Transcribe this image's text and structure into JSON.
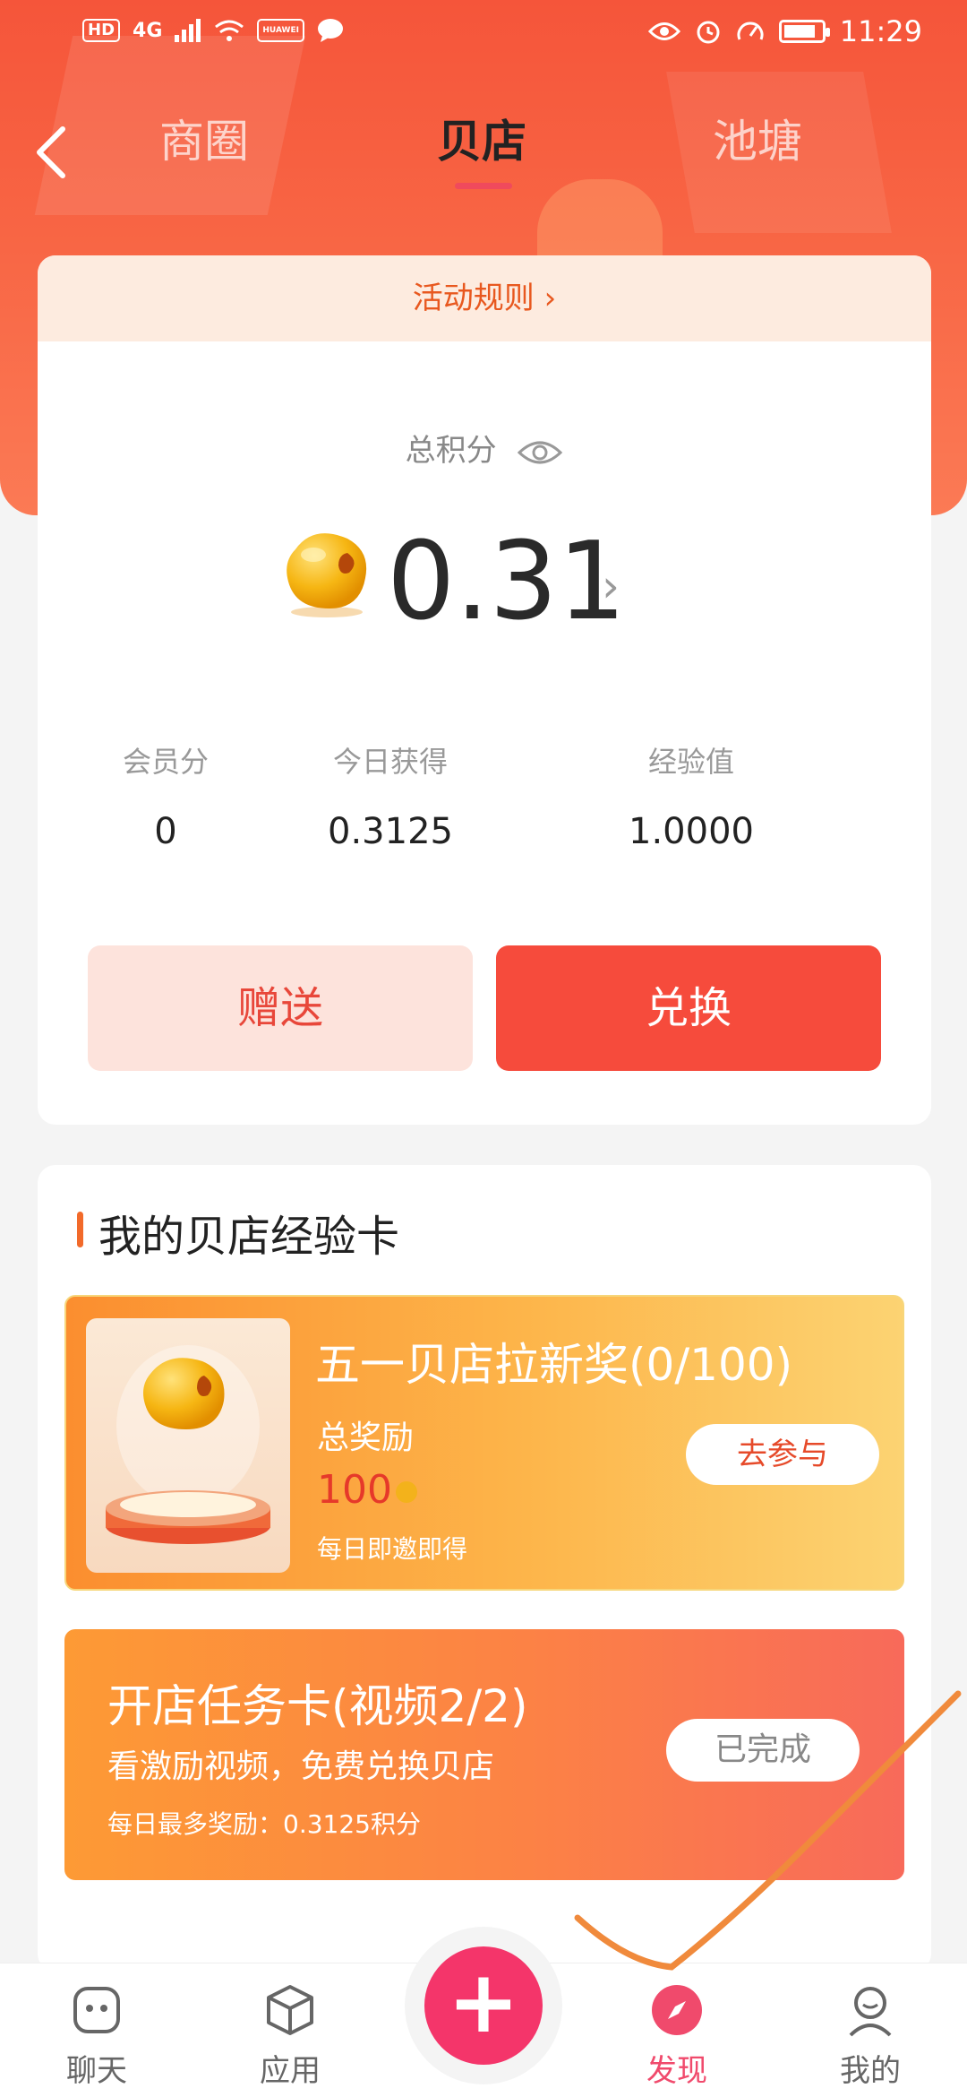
{
  "status_bar": {
    "left_badges": [
      "HD",
      "4G",
      "HUAWEI"
    ],
    "time": "11:29"
  },
  "nav": {
    "tabs": [
      {
        "label": "商圈",
        "active": false
      },
      {
        "label": "贝店",
        "active": true
      },
      {
        "label": "池塘",
        "active": false
      }
    ]
  },
  "points_card": {
    "rules_label": "活动规则 ›",
    "total_label": "总积分",
    "total_value": "0.31",
    "stats": [
      {
        "label": "会员分",
        "value": "0"
      },
      {
        "label": "今日获得",
        "value": "0.3125"
      },
      {
        "label": "经验值",
        "value": "1.0000"
      }
    ],
    "gift_button": "赠送",
    "exchange_button": "兑换"
  },
  "exp_section": {
    "title": "我的贝店经验卡",
    "card1": {
      "title": "五一贝店拉新奖(0/100)",
      "subtitle": "总奖励",
      "reward": "100",
      "note": "每日即邀即得",
      "button": "去参与"
    },
    "card2": {
      "title": "开店任务卡(视频2/2)",
      "subtitle": "看激励视频，免费兑换贝店",
      "note": "每日最多奖励：0.3125积分",
      "button": "已完成"
    }
  },
  "bottom_nav": {
    "items": [
      {
        "label": "聊天",
        "icon": "chat-icon",
        "active": false
      },
      {
        "label": "应用",
        "icon": "apps-cube-icon",
        "active": false
      },
      {
        "label": "+",
        "icon": "plus-icon",
        "active": false
      },
      {
        "label": "发现",
        "icon": "compass-icon",
        "active": true
      },
      {
        "label": "我的",
        "icon": "profile-icon",
        "active": false
      }
    ]
  },
  "colors": {
    "header_red": "#f5553a",
    "accent_red": "#f64b3c",
    "fab_pink": "#f4356a",
    "active_tab": "#f04a6c"
  }
}
